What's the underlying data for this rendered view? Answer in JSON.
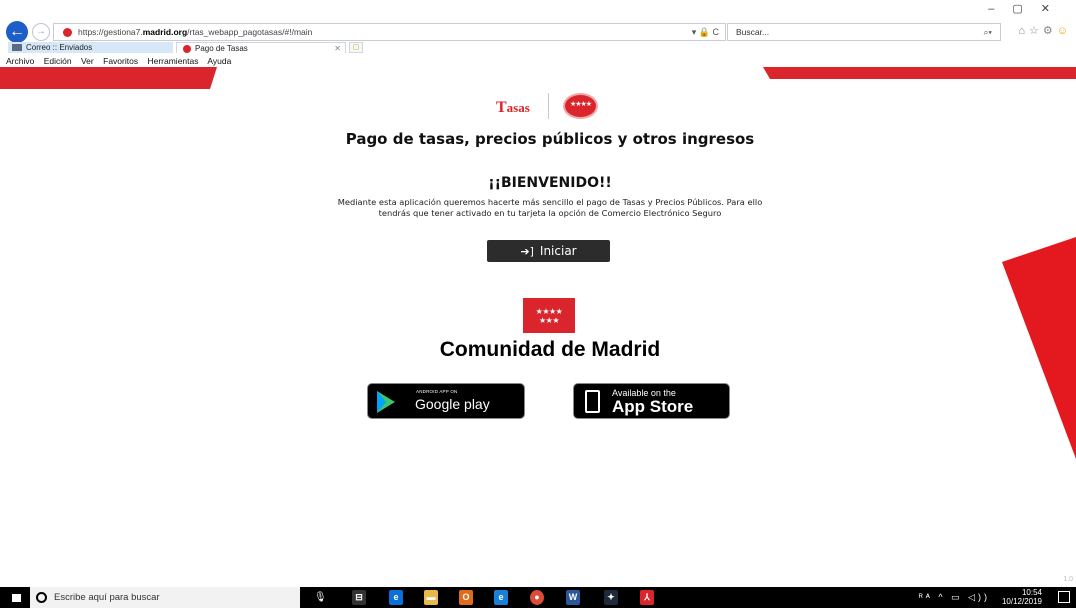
{
  "browser": {
    "url_prefix": "https://gestiona7.",
    "url_domain": "madrid.org",
    "url_path": "/rtas_webapp_pagotasas/#!/main",
    "address_controls": "▾ 🔒 C",
    "search_placeholder": "Buscar...",
    "tabs": [
      {
        "label": "Correo :: Enviados"
      },
      {
        "label": "Pago de Tasas"
      }
    ],
    "menu": [
      "Archivo",
      "Edición",
      "Ver",
      "Favoritos",
      "Herramientas",
      "Ayuda"
    ]
  },
  "page": {
    "logo_text_initial": "T",
    "logo_text_rest": "asas",
    "title": "Pago de tasas, precios públicos y otros ingresos",
    "welcome": "¡¡BIENVENIDO!!",
    "description": "Mediante esta aplicación queremos hacerte más sencillo el pago de Tasas y Precios Públicos. Para ello tendrás que tener activado en tu tarjeta la opción de Comercio Electrónico Seguro",
    "start_button": "Iniciar",
    "organization": "Comunidad de Madrid",
    "google_play_small": "ANDROID APP ON",
    "google_play_big": "Google play",
    "app_store_small": "Available on the",
    "app_store_big": "App Store",
    "version": "1.0"
  },
  "taskbar": {
    "search_placeholder": "Escribe aquí para buscar",
    "time": "10:54",
    "date": "10/12/2019"
  },
  "colors": {
    "brand_red": "#d9252b",
    "browser_blue": "#1e5fc7",
    "button_dark": "#2c2c2c"
  }
}
